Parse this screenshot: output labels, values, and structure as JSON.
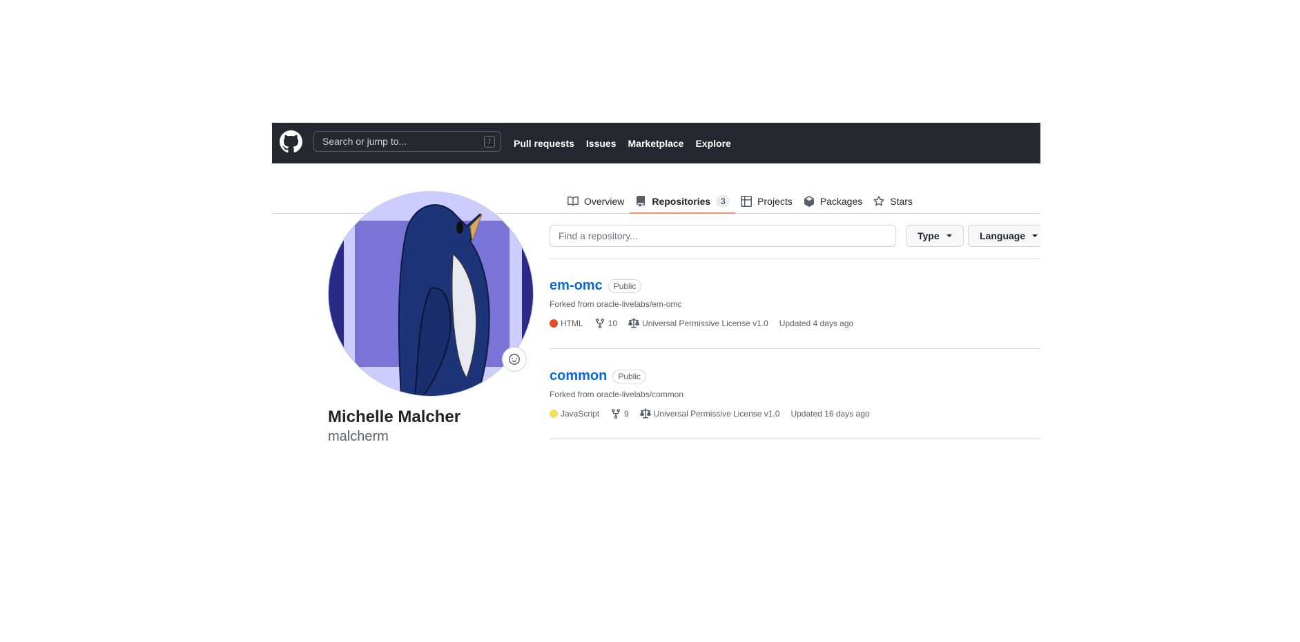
{
  "header": {
    "search_placeholder": "Search or jump to...",
    "search_shortcut": "/",
    "nav": [
      "Pull requests",
      "Issues",
      "Marketplace",
      "Explore"
    ]
  },
  "tabs": [
    {
      "label": "Overview",
      "icon": "book-icon"
    },
    {
      "label": "Repositories",
      "icon": "repo-icon",
      "count": "3",
      "active": true
    },
    {
      "label": "Projects",
      "icon": "table-icon"
    },
    {
      "label": "Packages",
      "icon": "package-icon"
    },
    {
      "label": "Stars",
      "icon": "star-icon"
    }
  ],
  "profile": {
    "full_name": "Michelle Malcher",
    "username": "malcherm"
  },
  "filters": {
    "find_placeholder": "Find a repository...",
    "type_label": "Type",
    "language_label": "Language"
  },
  "repos": [
    {
      "name": "em-omc",
      "visibility": "Public",
      "forked_prefix": "Forked from",
      "forked_from": "oracle-livelabs/em-omc",
      "language": "HTML",
      "language_color": "#e34c26",
      "forks": "10",
      "license": "Universal Permissive License v1.0",
      "updated": "Updated 4 days ago"
    },
    {
      "name": "common",
      "visibility": "Public",
      "forked_prefix": "Forked from",
      "forked_from": "oracle-livelabs/common",
      "language": "JavaScript",
      "language_color": "#f1e05a",
      "forks": "9",
      "license": "Universal Permissive License v1.0",
      "updated": "Updated 16 days ago"
    }
  ]
}
